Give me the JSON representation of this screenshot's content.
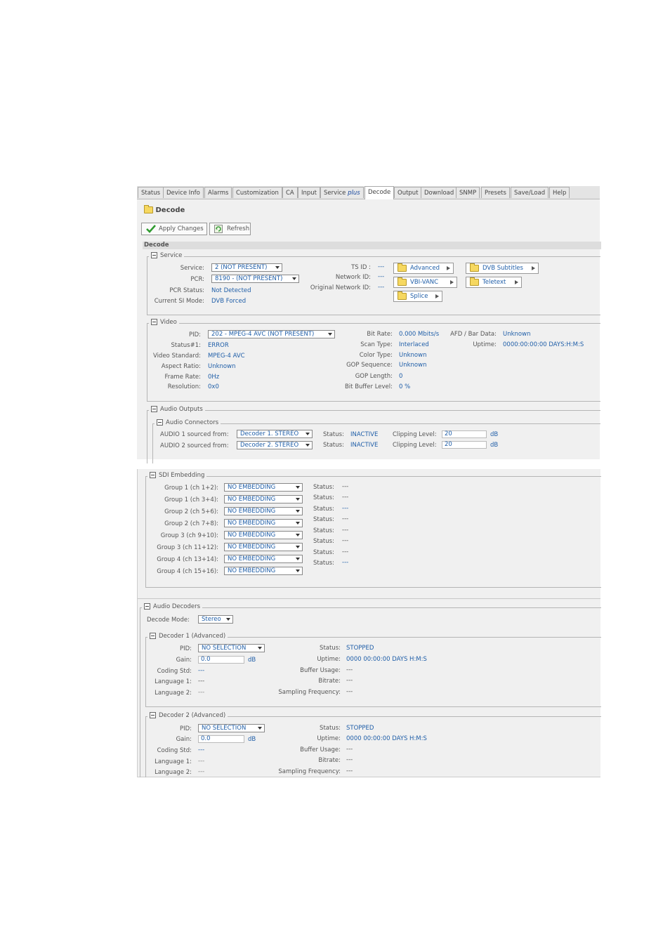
{
  "tabs": [
    {
      "label": "Status"
    },
    {
      "label": "Device Info"
    },
    {
      "label": "Alarms"
    },
    {
      "label": "Customization"
    },
    {
      "label": "CA"
    },
    {
      "label": "Input"
    },
    {
      "label": "Service",
      "label_italic": "plus"
    },
    {
      "label": "Decode"
    },
    {
      "label": "Output"
    },
    {
      "label": "Download"
    },
    {
      "label": "SNMP"
    },
    {
      "label": "Presets"
    },
    {
      "label": "Save/Load"
    },
    {
      "label": "Help"
    }
  ],
  "page_title": "Decode",
  "toolbar": {
    "apply": "Apply Changes",
    "refresh": "Refresh"
  },
  "section_header": "Decode",
  "service": {
    "legend": "Service",
    "service_label": "Service:",
    "service_value": "2 (NOT PRESENT)",
    "pcr_label": "PCR:",
    "pcr_value": "8190 - (NOT PRESENT)",
    "pcr_status_label": "PCR Status:",
    "pcr_status_value": "Not Detected",
    "si_mode_label": "Current SI Mode:",
    "si_mode_value": "DVB Forced",
    "ts_id_label": "TS ID :",
    "ts_id_value": "---",
    "network_id_label": "Network ID:",
    "network_id_value": "---",
    "orig_network_id_label": "Original Network ID:",
    "orig_network_id_value": "---",
    "buttons": {
      "advanced": "Advanced",
      "dvb_subtitles": "DVB Subtitles",
      "vbi_vanc": "VBI-VANC",
      "teletext": "Teletext",
      "splice": "Splice"
    }
  },
  "video": {
    "legend": "Video",
    "pid_label": "PID:",
    "pid_value": "202 - MPEG-4 AVC (NOT PRESENT)",
    "status_label": "Status#1:",
    "status_value": "ERROR",
    "standard_label": "Video Standard:",
    "standard_value": "MPEG-4 AVC",
    "aspect_label": "Aspect Ratio:",
    "aspect_value": "Unknown",
    "frame_label": "Frame Rate:",
    "frame_value": "0Hz",
    "res_label": "Resolution:",
    "res_value": "0x0",
    "bitrate_label": "Bit Rate:",
    "bitrate_value": "0.000 Mbits/s",
    "scan_label": "Scan Type:",
    "scan_value": "Interlaced",
    "color_label": "Color Type:",
    "color_value": "Unknown",
    "gop_seq_label": "GOP Sequence:",
    "gop_seq_value": "Unknown",
    "gop_len_label": "GOP Length:",
    "gop_len_value": "0",
    "buf_label": "Bit Buffer Level:",
    "buf_value": "0 %",
    "afd_label": "AFD / Bar Data:",
    "afd_value": "Unknown",
    "uptime_label": "Uptime:",
    "uptime_value": "0000:00:00:00 DAYS:H:M:S"
  },
  "audio_outputs": {
    "legend": "Audio Outputs",
    "connectors_legend": "Audio Connectors",
    "rows": [
      {
        "label": "AUDIO 1 sourced from:",
        "source": "Decoder 1. STEREO",
        "status_label": "Status:",
        "status": "INACTIVE",
        "clip_label": "Clipping Level:",
        "clip": "20",
        "unit": "dB"
      },
      {
        "label": "AUDIO 2 sourced from:",
        "source": "Decoder 2. STEREO",
        "status_label": "Status:",
        "status": "INACTIVE",
        "clip_label": "Clipping Level:",
        "clip": "20",
        "unit": "dB"
      }
    ]
  },
  "sdi": {
    "legend": "SDI Embedding",
    "groups": [
      {
        "label": "Group 1 (ch 1+2):",
        "value": "NO EMBEDDING"
      },
      {
        "label": "Group 1 (ch 3+4):",
        "value": "NO EMBEDDING"
      },
      {
        "label": "Group 2 (ch 5+6):",
        "value": "NO EMBEDDING"
      },
      {
        "label": "Group 2 (ch 7+8):",
        "value": "NO EMBEDDING"
      },
      {
        "label": "Group 3 (ch 9+10):",
        "value": "NO EMBEDDING"
      },
      {
        "label": "Group 3 (ch 11+12):",
        "value": "NO EMBEDDING"
      },
      {
        "label": "Group 4 (ch 13+14):",
        "value": "NO EMBEDDING"
      },
      {
        "label": "Group 4 (ch 15+16):",
        "value": "NO EMBEDDING"
      }
    ],
    "statuses": [
      {
        "label": "Status:",
        "value": "---"
      },
      {
        "label": "Status:",
        "value": "---"
      },
      {
        "label": "Status:",
        "value": "---"
      },
      {
        "label": "Status:",
        "value": "---"
      },
      {
        "label": "Status:",
        "value": "---"
      },
      {
        "label": "Status:",
        "value": "---"
      },
      {
        "label": "Status:",
        "value": "---"
      },
      {
        "label": "Status:",
        "value": "---"
      }
    ]
  },
  "audio_decoders": {
    "legend": "Audio Decoders",
    "mode_label": "Decode Mode:",
    "mode_value": "Stereo",
    "decoders": [
      {
        "legend": "Decoder 1 (Advanced)",
        "pid_label": "PID:",
        "pid": "NO SELECTION",
        "gain_label": "Gain:",
        "gain": "0.0",
        "gain_unit": "dB",
        "coding_label": "Coding Std:",
        "coding": "---",
        "lang1_label": "Language 1:",
        "lang1": "---",
        "lang2_label": "Language 2:",
        "lang2": "---",
        "status_label": "Status:",
        "status": "STOPPED",
        "uptime_label": "Uptime:",
        "uptime": "0000 00:00:00 DAYS H:M:S",
        "buffer_label": "Buffer Usage:",
        "buffer": "---",
        "bitrate_label": "Bitrate:",
        "bitrate": "---",
        "sampling_label": "Sampling Frequency:",
        "sampling": "---"
      },
      {
        "legend": "Decoder 2 (Advanced)",
        "pid_label": "PID:",
        "pid": "NO SELECTION",
        "gain_label": "Gain:",
        "gain": "0.0",
        "gain_unit": "dB",
        "coding_label": "Coding Std:",
        "coding": "---",
        "lang1_label": "Language 1:",
        "lang1": "---",
        "lang2_label": "Language 2:",
        "lang2": "---",
        "status_label": "Status:",
        "status": "STOPPED",
        "uptime_label": "Uptime:",
        "uptime": "0000 00:00:00 DAYS H:M:S",
        "buffer_label": "Buffer Usage:",
        "buffer": "---",
        "bitrate_label": "Bitrate:",
        "bitrate": "---",
        "sampling_label": "Sampling Frequency:",
        "sampling": "---"
      }
    ]
  },
  "colors": {
    "value_blue": "#1f5ea8",
    "panel_bg": "#f0f0f0",
    "checkmark": "#2e9a2e"
  }
}
